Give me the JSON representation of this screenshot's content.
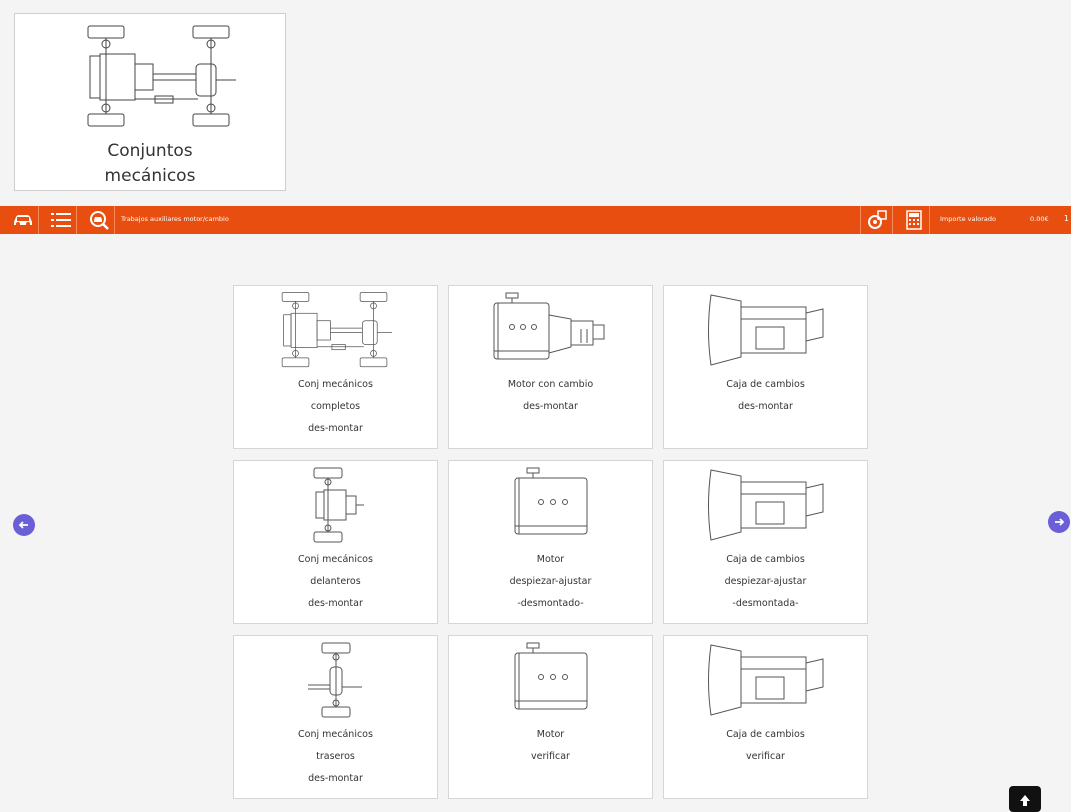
{
  "header": {
    "title_line1": "Conjuntos",
    "title_line2": "mecánicos",
    "icon": "chassis-drivetrain-icon"
  },
  "toolbar": {
    "section_title": "Trabajos auxiliares motor/cambio",
    "importe_label": "Importe valorado",
    "importe_value": "0.00€",
    "trailing": "1",
    "buttons": [
      "car-icon",
      "list-icon",
      "search-car-icon",
      "tool-settings-icon",
      "calculator-icon"
    ],
    "accent_color": "#e84e0f"
  },
  "tiles": [
    {
      "icon": "chassis-drivetrain-icon",
      "lines": [
        "Conj mecánicos",
        "completos",
        "des-montar"
      ]
    },
    {
      "icon": "engine-with-gearbox-icon",
      "lines": [
        "Motor con cambio",
        "des-montar",
        ""
      ]
    },
    {
      "icon": "gearbox-icon",
      "lines": [
        "Caja de cambios",
        "des-montar",
        ""
      ]
    },
    {
      "icon": "front-axle-icon",
      "lines": [
        "Conj mecánicos",
        "delanteros",
        "des-montar"
      ]
    },
    {
      "icon": "engine-icon",
      "lines": [
        "Motor",
        "despiezar-ajustar",
        "-desmontado-"
      ]
    },
    {
      "icon": "gearbox-icon",
      "lines": [
        "Caja de cambios",
        "despiezar-ajustar",
        "-desmontada-"
      ]
    },
    {
      "icon": "rear-axle-icon",
      "lines": [
        "Conj mecánicos",
        "traseros",
        "des-montar"
      ]
    },
    {
      "icon": "engine-icon",
      "lines": [
        "Motor",
        "verificar",
        ""
      ]
    },
    {
      "icon": "gearbox-icon",
      "lines": [
        "Caja de cambios",
        "verificar",
        ""
      ]
    }
  ],
  "navigation": {
    "prev": "arrow-left-icon",
    "next": "arrow-right-icon",
    "scroll_top": "arrow-up-icon",
    "arrow_color": "#6a5fd6"
  }
}
